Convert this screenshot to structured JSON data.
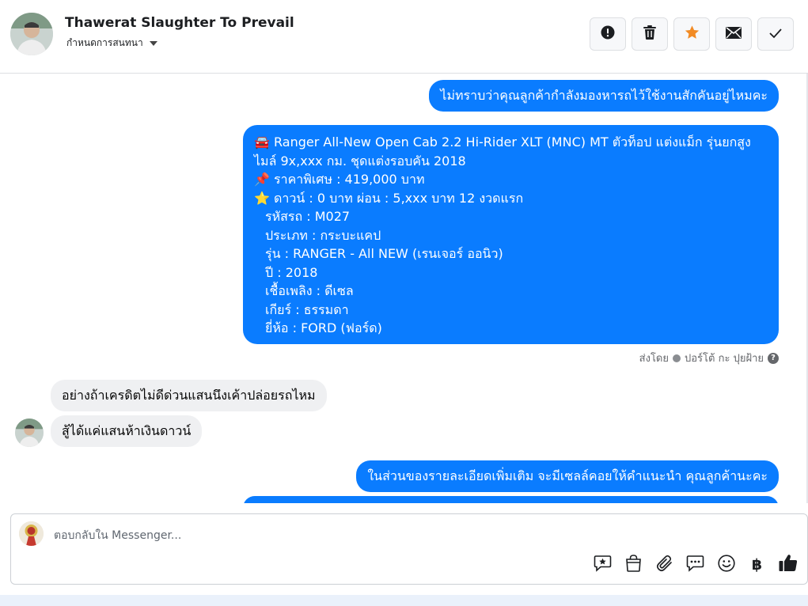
{
  "header": {
    "contact_name": "Thawerat Slaughter To Prevail",
    "assign_label": "กำหนดการสนทนา",
    "actions": [
      {
        "icon": "alert-icon"
      },
      {
        "icon": "trash-icon"
      },
      {
        "icon": "star-icon"
      },
      {
        "icon": "mail-icon"
      },
      {
        "icon": "check-icon"
      }
    ]
  },
  "messages": {
    "m1": "ไม่ทราบว่าคุณลูกค้ากำลังมองหารถไว้ใช้งานสักคันอยู่ไหมคะ",
    "m2": {
      "line1": "🚘 Ranger All-New Open Cab 2.2 Hi-Rider XLT (MNC) MT ตัวท็อป แต่งแม็ก รุ่นยกสูง",
      "line2": "ไมล์ 9x,xxx กม. ชุดแต่งรอบคัน 2018",
      "line3": "📌 ราคาพิเศษ : 419,000 บาท",
      "line4": "⭐ ดาวน์ : 0 บาท ผ่อน : 5,xxx บาท 12 งวดแรก",
      "line5": "รหัสรถ : M027",
      "line6": "ประเภท : กระบะแคป",
      "line7": "รุ่น : RANGER - All NEW (เรนเจอร์ ออนิว)",
      "line8": "ปี : 2018",
      "line9": "เชื้อเพลิง : ดีเซล",
      "line10": "เกียร์ : ธรรมดา",
      "line11": "ยี่ห้อ : FORD (ฟอร์ด)"
    },
    "sent_by_prefix": "ส่งโดย",
    "sent_by_name": "ปอร์โต้ กะ ปุยฝ้าย",
    "m3": "อย่างถ้าเครดิตไม่ดีด่วนแสนนึงเค้าปล่อยรถไหม",
    "m4": "สู้ได้แค่แสนห้าเงินดาวน์",
    "m5": "ในส่วนของรายละเอียดเพิ่มเติม จะมีเซลล์คอยให้คำแนะนำ คุณลูกค้านะคะ"
  },
  "composer": {
    "placeholder": "ตอบกลับใน Messenger...",
    "baht_symbol": "฿",
    "tools": [
      "saved-reply-icon",
      "shop-bag-icon",
      "attachment-icon",
      "chat-bubble-icon",
      "emoji-icon",
      "baht-icon",
      "thumbs-up-icon"
    ]
  },
  "colors": {
    "outgoing_bubble": "#0a7cff",
    "incoming_bubble": "#eff0f2",
    "star": "#f28b24"
  }
}
